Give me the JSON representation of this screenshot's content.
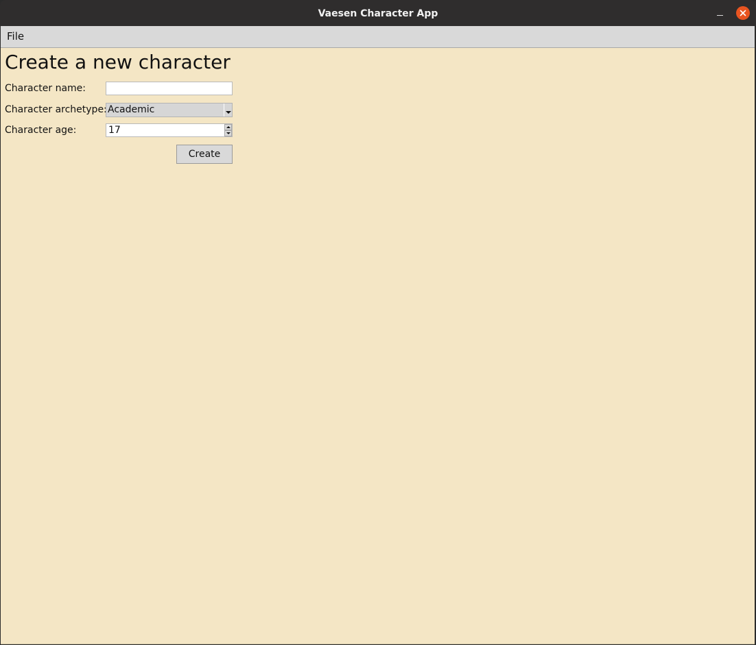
{
  "window": {
    "title": "Vaesen Character App"
  },
  "menubar": {
    "items": [
      {
        "label": "File"
      }
    ]
  },
  "form": {
    "heading": "Create a new character",
    "name_label": "Character name:",
    "name_value": "",
    "archetype_label": "Character archetype:",
    "archetype_value": "Academic",
    "age_label": "Character age:",
    "age_value": "17",
    "create_label": "Create"
  },
  "icons": {
    "minimize": "minimize-icon",
    "close": "close-icon",
    "dropdown": "chevron-down-icon",
    "spin_up": "arrow-up-icon",
    "spin_down": "arrow-down-icon"
  },
  "colors": {
    "titlebar": "#2f2d2d",
    "close_button": "#e95420",
    "menubar": "#d9d9d9",
    "background": "#f4e6c5",
    "button": "#d9d9d9"
  }
}
